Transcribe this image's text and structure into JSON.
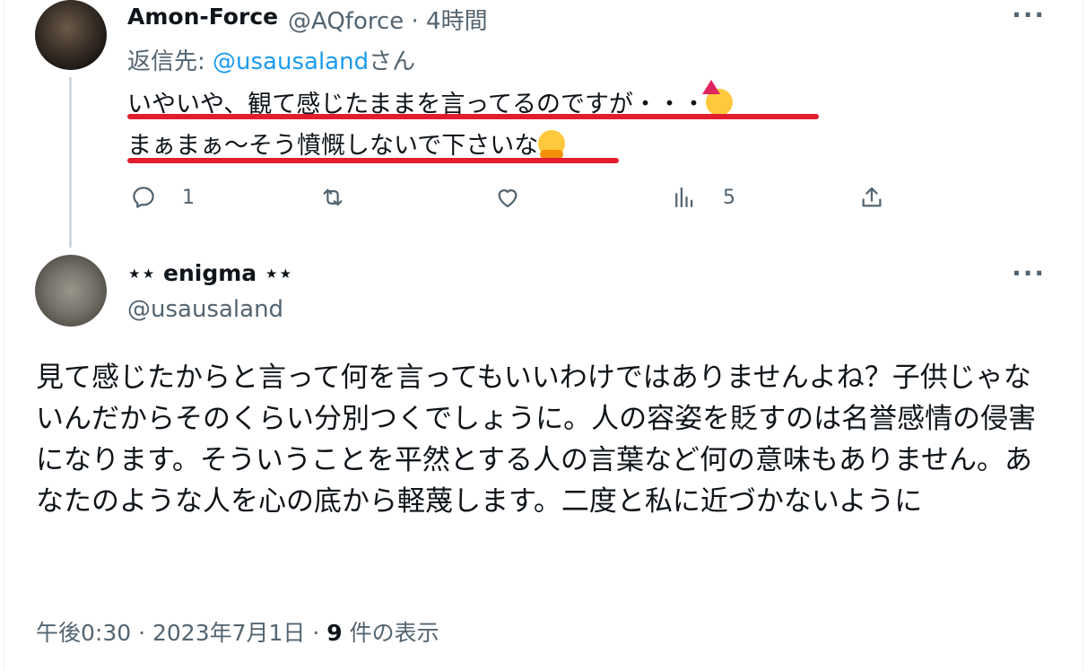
{
  "reply": {
    "author_name": "Amon-Force",
    "author_handle": "@AQforce",
    "time": "· 4時間",
    "reply_prefix": "返信先: ",
    "reply_mention": "@usausaland",
    "reply_suffix": "さん",
    "text_line1": "いやいや、観て感じたままを言ってるのですが・・・",
    "text_line2": "まぁまぁ〜そう憤慨しないで下さいな",
    "more": "···",
    "actions": {
      "reply_count": "1",
      "retweet_count": "",
      "like_count": "",
      "views_count": "5"
    },
    "emoji_line1": "partying-face",
    "emoji_line2": "hugging-face",
    "underline_color": "#e11d2f"
  },
  "main": {
    "author_name": "⋆⋆ enigma ⋆⋆",
    "author_handle": "@usausaland",
    "more": "···",
    "text": "見て感じたからと言って何を言ってもいいわけではありませんよね？子供じゃないんだからそのくらい分別つくでしょうに。人の容姿を貶すのは名誉感情の侵害になります。そういうことを平然とする人の言葉など何の意味もありません。あなたのような人を心の底から軽蔑します。二度と私に近づかないように",
    "timestamp": "午後0:30 · 2023年7月1日 · ",
    "views_number": "9",
    "views_suffix": " 件の表示"
  },
  "colors": {
    "text": "#0f1419",
    "secondary": "#536471",
    "link": "#1d9bf0"
  }
}
